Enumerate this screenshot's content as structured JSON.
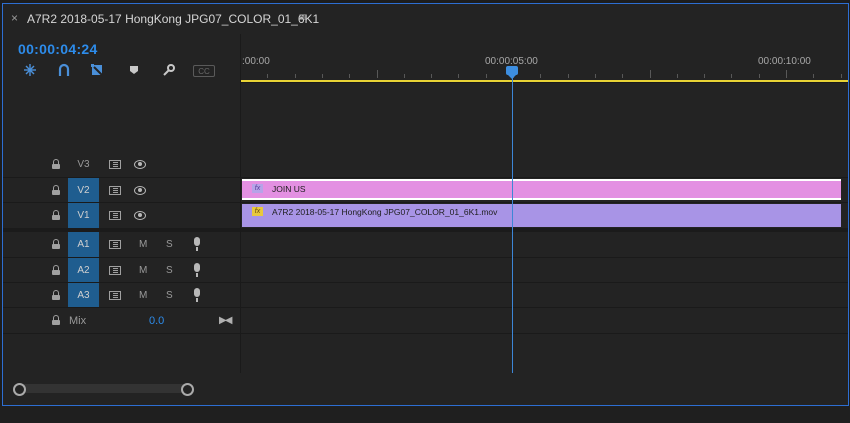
{
  "panel": {
    "title": "A7R2 2018-05-17 HongKong JPG07_COLOR_01_6K1",
    "close_icon": "×",
    "menu_icon": "≡"
  },
  "timecode": "00:00:04:24",
  "toolbar": {
    "tools": [
      "snap-icon",
      "linked-selection-icon",
      "add-marker-icon",
      "marker-icon",
      "wrench-icon",
      "captions-icon"
    ],
    "captions_label": "CC"
  },
  "ruler": {
    "labels": [
      ":00:00",
      "00:00:05:00",
      "00:00:10:00"
    ],
    "playhead_time": "00:00:05:00"
  },
  "tracks": {
    "video": [
      {
        "name": "V3",
        "targeted": false
      },
      {
        "name": "V2",
        "targeted": true
      },
      {
        "name": "V1",
        "targeted": true
      }
    ],
    "audio": [
      {
        "name": "A1",
        "targeted": true,
        "mute": "M",
        "solo": "S"
      },
      {
        "name": "A2",
        "targeted": true,
        "mute": "M",
        "solo": "S"
      },
      {
        "name": "A3",
        "targeted": true,
        "mute": "M",
        "solo": "S"
      }
    ],
    "mix": {
      "label": "Mix",
      "value": "0.0"
    }
  },
  "clips": {
    "v2": {
      "label": "JOIN US",
      "fx": "fx",
      "color": "#e390e2"
    },
    "v1": {
      "label": "A7R2 2018-05-17 HongKong JPG07_COLOR_01_6K1.mov",
      "fx": "fx",
      "color": "#a894e6"
    }
  },
  "colors": {
    "accent": "#2d8ceb",
    "track_target": "#1f5d8f",
    "work_area_bar": "#e8d335",
    "fx_badge_yellow": "#e8c93c"
  }
}
